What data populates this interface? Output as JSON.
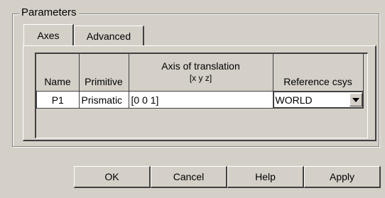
{
  "parameters": {
    "title": "Parameters",
    "tabs": [
      {
        "label": "Axes",
        "active": true
      },
      {
        "label": "Advanced",
        "active": false
      }
    ],
    "table": {
      "headers": {
        "name": "Name",
        "primitive": "Primitive",
        "axis_line1": "Axis of translation",
        "axis_line2": "[x y z]",
        "reference": "Reference csys"
      },
      "rows": [
        {
          "name": "P1",
          "primitive": "Prismatic",
          "axis": "[0 0 1]",
          "reference": "WORLD"
        }
      ]
    }
  },
  "buttons": {
    "ok": "OK",
    "cancel": "Cancel",
    "help": "Help",
    "apply": "Apply"
  }
}
